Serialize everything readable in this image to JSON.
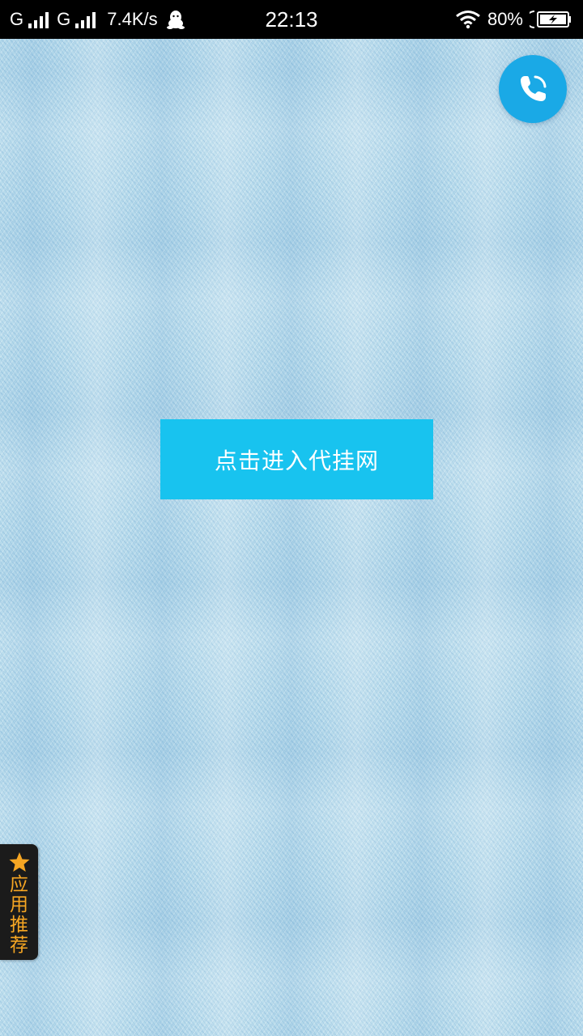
{
  "status_bar": {
    "network1": "G",
    "network2": "G",
    "speed": "7.4K/s",
    "time": "22:13",
    "battery_percent": "80%",
    "icons": [
      "signal-icon",
      "qq-icon",
      "wifi-icon",
      "battery-charging-icon"
    ]
  },
  "call_button": {
    "icon": "phone-icon",
    "color": "#1aa9e6"
  },
  "main": {
    "enter_label": "点击进入代挂网",
    "enter_color": "#18c3ef"
  },
  "recommend": {
    "icon": "star-icon",
    "label": "应用推荐",
    "accent": "#f6a623"
  }
}
